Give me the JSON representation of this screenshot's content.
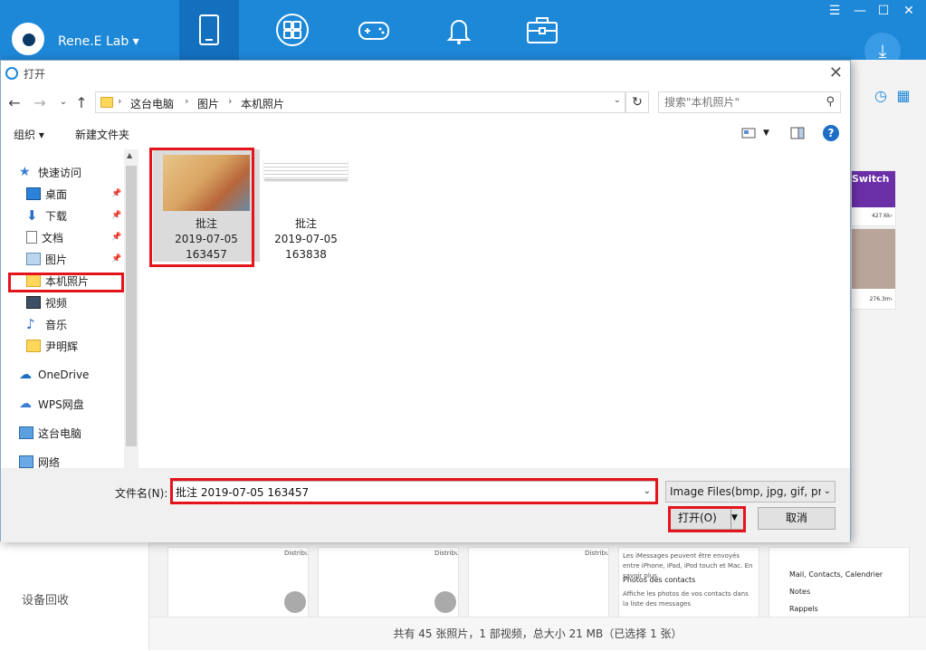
{
  "app": {
    "brand": "Rene.E Lab ▾",
    "window_controls": [
      "☰",
      "—",
      "☐",
      "✕"
    ],
    "status": "共有 45 张照片，1 部视频，总大小 21 MB（已选择 1 张）",
    "behind_sidebar_label": "设备回收",
    "right_thumbs": [
      "Switch",
      "427.6k›",
      "276.3m›"
    ],
    "bottom_thumbs": [
      {
        "top": "Distribué"
      },
      {
        "top": "Distribué"
      },
      {
        "top": "Distribué"
      },
      {
        "lines": [
          "Les iMessages peuvent être envoyés entre iPhone, iPad, iPod touch et Mac. En savoir plus.",
          "Photos des contacts",
          "Affiche les photos de vos contacts dans la liste des messages"
        ]
      },
      {
        "lines": [
          "Mail, Contacts, Calendrier",
          "Notes",
          "Rappels"
        ]
      }
    ]
  },
  "dialog": {
    "title": "打开",
    "breadcrumb": [
      "这台电脑",
      "图片",
      "本机照片"
    ],
    "search_placeholder": "搜索\"本机照片\"",
    "organize": "组织 ▾",
    "new_folder": "新建文件夹",
    "nav": [
      {
        "label": "快速访问",
        "icon": "star-icon"
      },
      {
        "label": "桌面",
        "icon": "desktop-icon",
        "pinned": true
      },
      {
        "label": "下载",
        "icon": "download-icon",
        "pinned": true
      },
      {
        "label": "文档",
        "icon": "document-icon",
        "pinned": true
      },
      {
        "label": "图片",
        "icon": "pictures-icon",
        "pinned": true
      },
      {
        "label": "本机照片",
        "icon": "folder-icon"
      },
      {
        "label": "视频",
        "icon": "video-icon"
      },
      {
        "label": "音乐",
        "icon": "music-icon"
      },
      {
        "label": "尹明辉",
        "icon": "folder-icon"
      },
      {
        "label": "OneDrive",
        "icon": "cloud-icon"
      },
      {
        "label": "WPS网盘",
        "icon": "cloud-icon"
      },
      {
        "label": "这台电脑",
        "icon": "computer-icon"
      },
      {
        "label": "网络",
        "icon": "network-icon"
      }
    ],
    "files": [
      {
        "name": "批注",
        "date": "2019-07-05",
        "time": "163457"
      },
      {
        "name": "批注",
        "date": "2019-07-05",
        "time": "163838"
      }
    ],
    "filename_label": "文件名(N):",
    "filename_value": "批注 2019-07-05 163457",
    "filetype": "Image Files(bmp, jpg, gif, pr",
    "open_label": "打开(O)",
    "cancel_label": "取消"
  }
}
